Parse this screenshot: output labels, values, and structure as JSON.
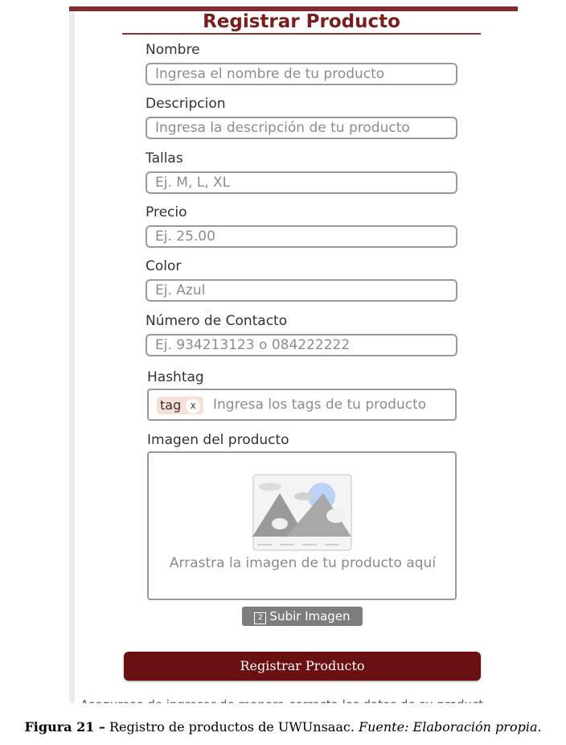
{
  "form": {
    "title": "Registrar Producto",
    "fields": [
      {
        "label": "Nombre",
        "placeholder": "Ingresa el nombre de tu producto"
      },
      {
        "label": "Descripcion",
        "placeholder": "Ingresa la descripción de tu producto"
      },
      {
        "label": "Tallas",
        "placeholder": "Ej. M, L, XL"
      },
      {
        "label": "Precio",
        "placeholder": "Ej. 25.00"
      },
      {
        "label": "Color",
        "placeholder": "Ej. Azul"
      },
      {
        "label": "Número de Contacto",
        "placeholder": "Ej. 934213123 o 084222222"
      }
    ],
    "hashtag": {
      "label": "Hashtag",
      "tag": "tag",
      "remove": "x",
      "placeholder": "Ingresa los tags de tu producto"
    },
    "image": {
      "label": "Imagen del producto",
      "drop_text": "Arrastra la imagen de tu producto aquí",
      "upload_icon": "2",
      "upload_label": "Subir Imagen"
    },
    "submit_label": "Registrar Producto",
    "note": "Asegurese de ingresar de manera correcta los datos de su product"
  },
  "caption": {
    "figure": "Figura 21 –",
    "text": " Registro de productos  de UWUnsaac. ",
    "source": "Fuente: Elaboración propia."
  },
  "colors": {
    "accent": "#6a0f12",
    "title": "#7a1d1d",
    "upload_button": "#7d7d7d",
    "tag_chip": "#f6e0d8"
  }
}
